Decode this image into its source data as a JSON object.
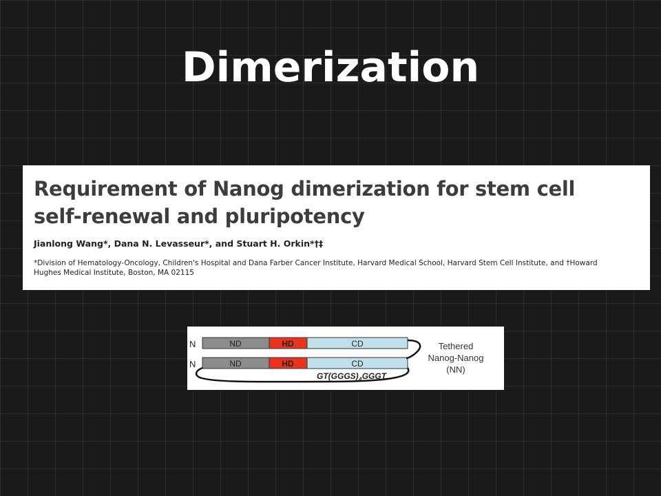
{
  "slide": {
    "title": "Dimerization"
  },
  "paper": {
    "title_line1": "Requirement of Nanog dimerization for stem cell",
    "title_line2": "self-renewal and pluripotency",
    "authors": "Jianlong Wang*, Dana N. Levasseur*, and Stuart H. Orkin*†‡",
    "affiliation_line1": "*Division of Hematology-Oncology, Children's Hospital and Dana Farber Cancer Institute, Harvard Medical School, Harvard Stem Cell Institute, and †Howard",
    "affiliation_line2": "Hughes Medical Institute, Boston, MA 02115"
  },
  "figure": {
    "n_label": "N",
    "domains": {
      "nd": "ND",
      "hd": "HD",
      "cd": "CD"
    },
    "linker_text": "GT(GGGS)",
    "linker_subscript": "4",
    "linker_tail": "GGGT",
    "caption_line1": "Tethered",
    "caption_line2": "Nanog-Nanog",
    "caption_line3": "(NN)",
    "colors": {
      "nd": "#8c8c8c",
      "hd": "#e8341c",
      "cd": "#bfe0ea"
    }
  }
}
